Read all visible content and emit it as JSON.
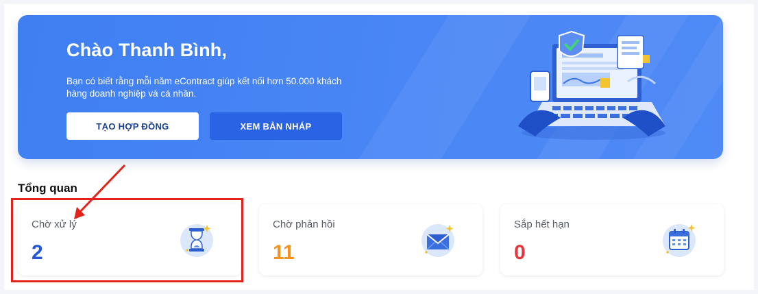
{
  "banner": {
    "greeting": "Chào Thanh Bình,",
    "description": "Bạn có biết rằng mỗi năm eContract giúp kết nối hơn 50.000 khách hàng doanh nghiệp và cá nhân.",
    "create_button": "TẠO HỢP ĐỒNG",
    "draft_button": "XEM BẢN NHÁP"
  },
  "overview": {
    "title": "Tổng quan",
    "cards": [
      {
        "label": "Chờ xử lý",
        "value": "2",
        "color": "#2458d6",
        "icon": "hourglass-icon"
      },
      {
        "label": "Chờ phản hồi",
        "value": "11",
        "color": "#f5911f",
        "icon": "envelope-icon"
      },
      {
        "label": "Sắp hết hạn",
        "value": "0",
        "color": "#e8343c",
        "icon": "calendar-icon"
      }
    ]
  },
  "colors": {
    "banner": "#4a86f5",
    "highlight": "#e2231a"
  }
}
